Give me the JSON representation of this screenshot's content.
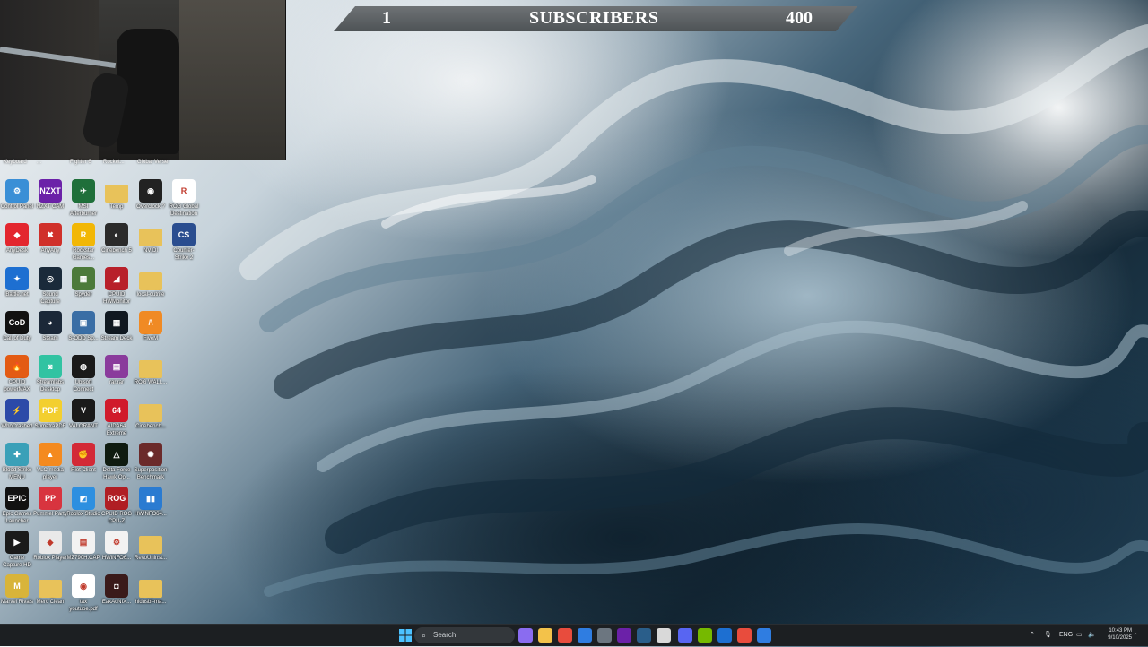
{
  "banner": {
    "left_value": "1",
    "title": "SUBSCRIBERS",
    "right_value": "400"
  },
  "cut_labels": [
    "Keyboard",
    "...",
    "Fighter 6",
    "Rocket...",
    "Global Verse"
  ],
  "icons": [
    {
      "label": "Control Panel",
      "icon": "control-panel-icon",
      "color": "#3a8fd6",
      "glyph": "⚙"
    },
    {
      "label": "NZXT CAM",
      "icon": "nzxt-cam-icon",
      "color": "#6b21a8",
      "glyph": "NZXT"
    },
    {
      "label": "MSI Afterburner",
      "icon": "msi-afterburner-icon",
      "color": "#1f6f3a",
      "glyph": "✈"
    },
    {
      "label": "Temp",
      "icon": "folder-icon",
      "color": "#e8c25a",
      "glyph": ""
    },
    {
      "label": "Overclock ?",
      "icon": "overclock-icon",
      "color": "#222222",
      "glyph": "◉"
    },
    {
      "label": "ROG Global Destination",
      "icon": "rog-icon",
      "color": "#ffffff",
      "glyph": "R"
    },
    {
      "label": "AnyDesk",
      "icon": "anydesk-icon",
      "color": "#e3262e",
      "glyph": "◆"
    },
    {
      "label": "AnyAny",
      "icon": "anyany-icon",
      "color": "#d0302a",
      "glyph": "✖"
    },
    {
      "label": "Rockstar Games...",
      "icon": "rockstar-icon",
      "color": "#f2b705",
      "glyph": "R"
    },
    {
      "label": "Cinebench 5",
      "icon": "cinebench-icon",
      "color": "#2b2b2b",
      "glyph": "◐"
    },
    {
      "label": "NVIDI",
      "icon": "folder-icon",
      "color": "#e8c25a",
      "glyph": ""
    },
    {
      "label": "Counter-Strike 2",
      "icon": "counter-strike-icon",
      "color": "#2a4d8f",
      "glyph": "CS"
    },
    {
      "label": "Battle.net",
      "icon": "battlenet-icon",
      "color": "#1d6fd1",
      "glyph": "✦"
    },
    {
      "label": "Sound Capture",
      "icon": "sound-capture-icon",
      "color": "#1a2a3a",
      "glyph": "◎"
    },
    {
      "label": "Spyder",
      "icon": "spyder-icon",
      "color": "#4c7a3a",
      "glyph": "▦"
    },
    {
      "label": "CPUID HWMonitor",
      "icon": "hwmonitor-icon",
      "color": "#b8202a",
      "glyph": "◢"
    },
    {
      "label": "local-cutrite",
      "icon": "folder-icon",
      "color": "#e8c25a",
      "glyph": ""
    },
    {
      "label": "Call of Duty",
      "icon": "call-of-duty-icon",
      "color": "#111111",
      "glyph": "CoD"
    },
    {
      "label": "Steam",
      "icon": "steam-icon",
      "color": "#1b2838",
      "glyph": "◕"
    },
    {
      "label": "S-ODD Sp...",
      "icon": "odd-icon",
      "color": "#3a6ea5",
      "glyph": "▣"
    },
    {
      "label": "Stream Deck",
      "icon": "stream-deck-icon",
      "color": "#101820",
      "glyph": "▦"
    },
    {
      "label": "FiveM",
      "icon": "fivem-icon",
      "color": "#f08a24",
      "glyph": "/\\"
    },
    {
      "label": "CPUID powerMAX",
      "icon": "powermax-icon",
      "color": "#e35b14",
      "glyph": "🔥"
    },
    {
      "label": "Streamlabs Desktop",
      "icon": "streamlabs-icon",
      "color": "#31c3a2",
      "glyph": "◙"
    },
    {
      "label": "Ubisoft Connect",
      "icon": "ubisoft-icon",
      "color": "#1a1a1a",
      "glyph": "◍"
    },
    {
      "label": "rar.rar",
      "icon": "winrar-icon",
      "color": "#8a3b9c",
      "glyph": "▤"
    },
    {
      "label": "ROG WALL...",
      "icon": "folder-icon",
      "color": "#e8c25a",
      "glyph": ""
    },
    {
      "label": "WhoCrashed",
      "icon": "whocrashed-icon",
      "color": "#2c4aa8",
      "glyph": "⚡"
    },
    {
      "label": "SumatraPDF",
      "icon": "sumatrapdf-icon",
      "color": "#f3cf2f",
      "glyph": "PDF"
    },
    {
      "label": "VALORANT",
      "icon": "valorant-icon",
      "color": "#1a1a1a",
      "glyph": "V"
    },
    {
      "label": "AIDA64 Extreme",
      "icon": "aida64-icon",
      "color": "#d01a2b",
      "glyph": "64"
    },
    {
      "label": "Cinebench...",
      "icon": "folder-icon",
      "color": "#e8c25a",
      "glyph": ""
    },
    {
      "label": "Blood Strike MENU",
      "icon": "blood-strike-icon",
      "color": "#3aa0b8",
      "glyph": "✚"
    },
    {
      "label": "VLC media player",
      "icon": "vlc-icon",
      "color": "#f48a1f",
      "glyph": "▲"
    },
    {
      "label": "Riot Client",
      "icon": "riot-client-icon",
      "color": "#d32936",
      "glyph": "✊"
    },
    {
      "label": "Delta Force Hawk Op...",
      "icon": "delta-force-icon",
      "color": "#0f1b10",
      "glyph": "△"
    },
    {
      "label": "Superposition Benchmark",
      "icon": "superposition-icon",
      "color": "#6b2a2a",
      "glyph": "✺"
    },
    {
      "label": "Epic Games Launcher",
      "icon": "epic-games-icon",
      "color": "#111111",
      "glyph": "EPIC"
    },
    {
      "label": "Pummel Party",
      "icon": "pummel-party-icon",
      "color": "#d8343f",
      "glyph": "PP"
    },
    {
      "label": "Roblox Studio",
      "icon": "roblox-studio-icon",
      "color": "#2d8fe0",
      "glyph": "◩"
    },
    {
      "label": "CPUID ROG CPU-Z",
      "icon": "cpuz-icon",
      "color": "#b01e24",
      "glyph": "ROG"
    },
    {
      "label": "HWiNFO64...",
      "icon": "hwinfo-icon",
      "color": "#2a7bd1",
      "glyph": "▮▮"
    },
    {
      "label": "Game Capture HD",
      "icon": "game-capture-icon",
      "color": "#1a1a1a",
      "glyph": "▶"
    },
    {
      "label": "Roblox Player",
      "icon": "roblox-player-icon",
      "color": "#e9e9e9",
      "glyph": "◆"
    },
    {
      "label": "MZ790H.CAP",
      "icon": "file-icon",
      "color": "#f2f2f2",
      "glyph": "▤"
    },
    {
      "label": "HWiNFO6...",
      "icon": "file-icon",
      "color": "#f2f2f2",
      "glyph": "⚙"
    },
    {
      "label": "RevoUninst...",
      "icon": "folder-icon",
      "color": "#e8c25a",
      "glyph": ""
    },
    {
      "label": "Marvel Rivals",
      "icon": "marvel-rivals-icon",
      "color": "#d8b43a",
      "glyph": "M"
    },
    {
      "label": "Merc Clean",
      "icon": "folder-icon",
      "color": "#e8c25a",
      "glyph": ""
    },
    {
      "label": "tax youtube.pdf",
      "icon": "chrome-pdf-icon",
      "color": "#ffffff",
      "glyph": "◉"
    },
    {
      "label": "EakAcNIX...",
      "icon": "app-icon",
      "color": "#3a1a1a",
      "glyph": "◘"
    },
    {
      "label": "hidusbf-ma...",
      "icon": "folder-icon",
      "color": "#e8c25a",
      "glyph": ""
    }
  ],
  "taskbar": {
    "search_placeholder": "Search",
    "apps": [
      {
        "name": "start-icon",
        "color": "#3aa0ff"
      },
      {
        "name": "copilot-icon",
        "color": "#8a6cf0"
      },
      {
        "name": "file-explorer-icon",
        "color": "#f3c24a"
      },
      {
        "name": "chrome-icon",
        "color": "#e84c3d"
      },
      {
        "name": "store-icon",
        "color": "#2f7de1"
      },
      {
        "name": "settings-icon",
        "color": "#6c7680"
      },
      {
        "name": "nzxt-icon",
        "color": "#6b21a8"
      },
      {
        "name": "steam-icon",
        "color": "#2a5e8a"
      },
      {
        "name": "obs-icon",
        "color": "#d9d9d9"
      },
      {
        "name": "discord-icon",
        "color": "#5865f2"
      },
      {
        "name": "geforce-icon",
        "color": "#76b900"
      },
      {
        "name": "battlenet-icon",
        "color": "#1d6fd1"
      },
      {
        "name": "chrome-alt-icon",
        "color": "#e84c3d"
      },
      {
        "name": "app-icon",
        "color": "#2f7de1"
      }
    ],
    "lang": "ENG",
    "time": "10:43 PM",
    "date": "9/10/2025"
  }
}
